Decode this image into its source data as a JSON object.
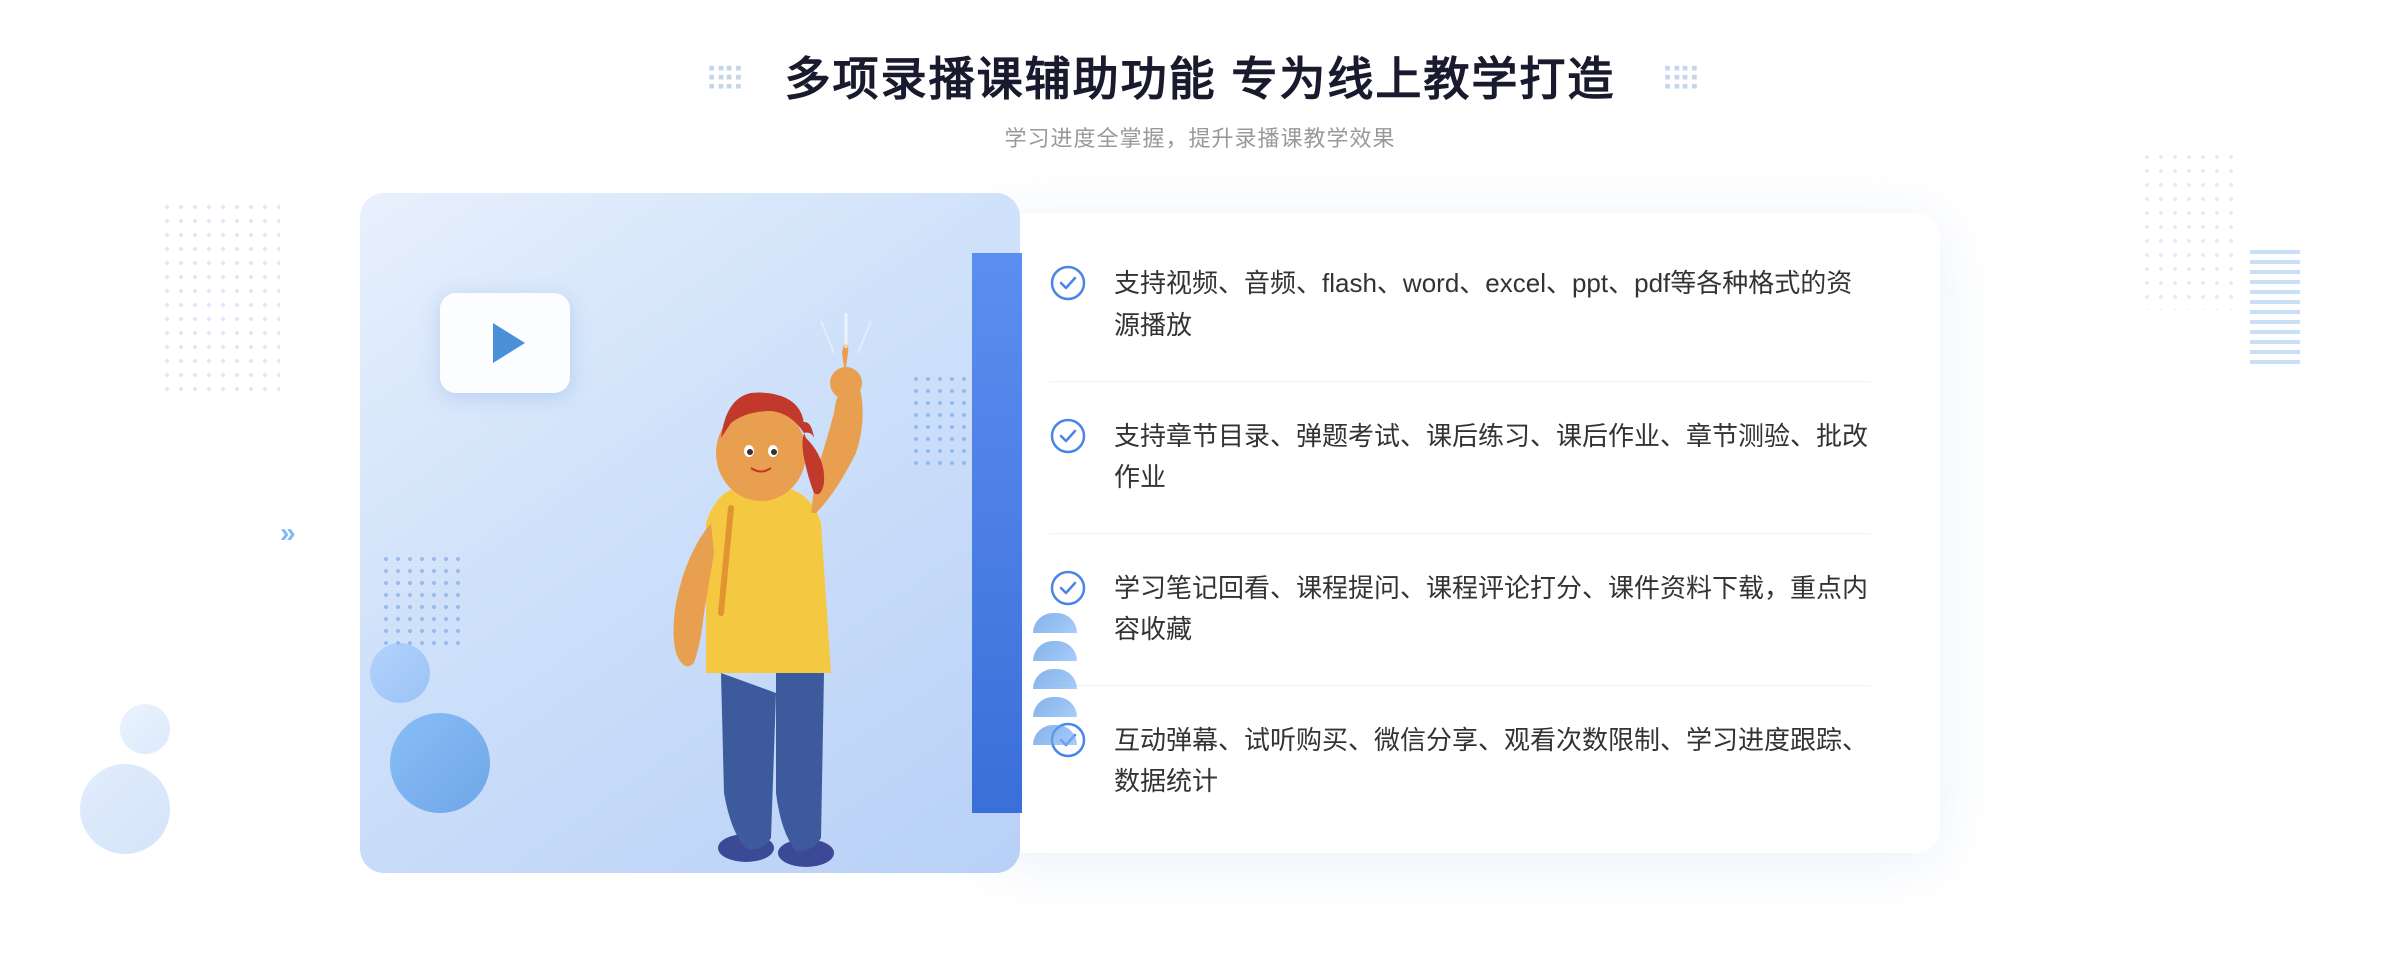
{
  "header": {
    "title": "多项录播课辅助功能 专为线上教学打造",
    "subtitle": "学习进度全掌握，提升录播课教学效果",
    "arrow_left": "❮❮",
    "arrow_right": "❯❯"
  },
  "features": [
    {
      "id": 1,
      "text": "支持视频、音频、flash、word、excel、ppt、pdf等各种格式的资源播放"
    },
    {
      "id": 2,
      "text": "支持章节目录、弹题考试、课后练习、课后作业、章节测验、批改作业"
    },
    {
      "id": 3,
      "text": "学习笔记回看、课程提问、课程评论打分、课件资料下载，重点内容收藏"
    },
    {
      "id": 4,
      "text": "互动弹幕、试听购买、微信分享、观看次数限制、学习进度跟踪、数据统计"
    }
  ],
  "icons": {
    "check": "check-circle-icon",
    "play": "play-icon"
  },
  "colors": {
    "primary": "#4a85e8",
    "light_blue": "#e8f0fc",
    "text_dark": "#1a1a2e",
    "text_gray": "#999",
    "text_body": "#333"
  }
}
